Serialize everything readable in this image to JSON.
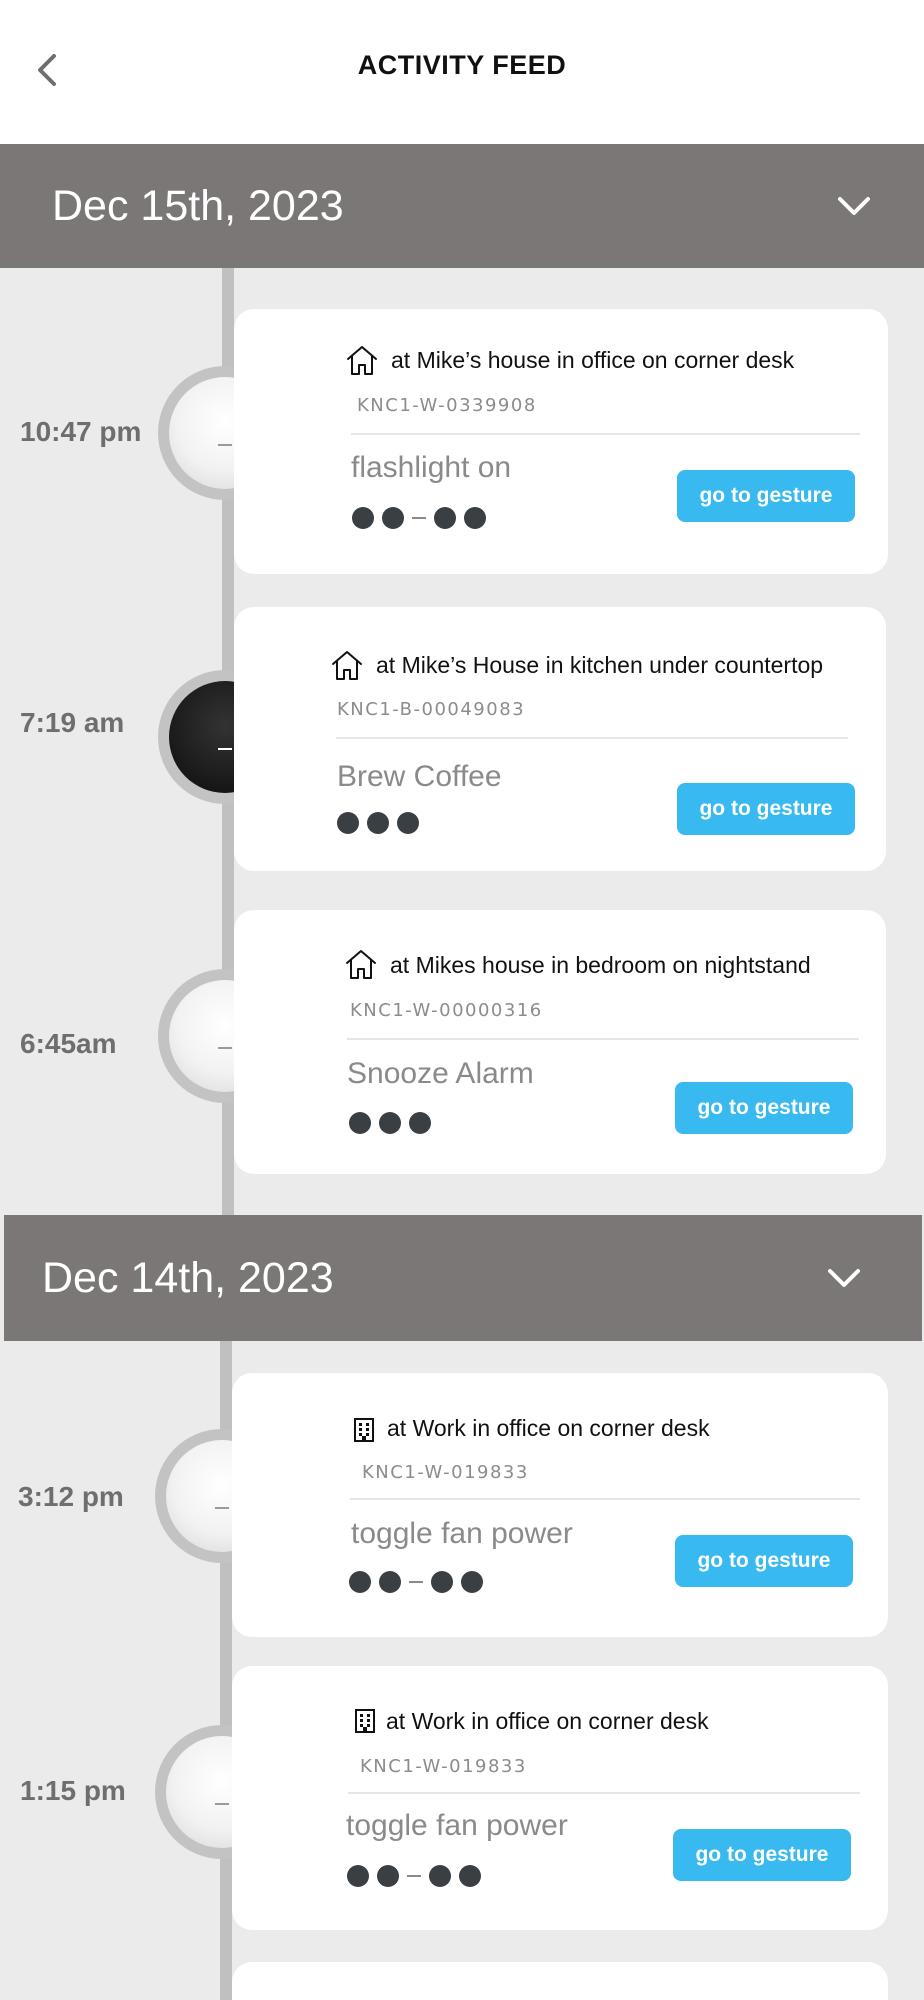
{
  "header": {
    "title": "ACTIVITY FEED"
  },
  "groups": [
    {
      "date": "Dec 15th, 2023"
    },
    {
      "date": "Dec 14th, 2023"
    }
  ],
  "entries": [
    {
      "time": "10:47 pm",
      "location": "at Mike’s house in office on corner desk",
      "location_icon": "home-icon",
      "device_id": "KNC1-W-0339908",
      "action": "flashlight on",
      "pattern": "●● – ●●",
      "device_color": "white",
      "button": "go to gesture"
    },
    {
      "time": "7:19 am",
      "location": "at Mike’s House in kitchen under countertop",
      "location_icon": "home-icon",
      "device_id": "KNC1-B-00049083",
      "action": "Brew Coffee",
      "pattern": "●●●",
      "device_color": "black",
      "button": "go to gesture"
    },
    {
      "time": "6:45am",
      "location": "at Mikes house in bedroom on nightstand",
      "location_icon": "home-icon",
      "device_id": "KNC1-W-00000316",
      "action": "Snooze Alarm",
      "pattern": "●●●",
      "device_color": "white",
      "button": "go to gesture"
    },
    {
      "time": "3:12 pm",
      "location": "at Work in office on corner desk",
      "location_icon": "building-icon",
      "device_id": "KNC1-W-019833",
      "action": "toggle fan power",
      "pattern": "●● – ●●",
      "device_color": "white",
      "button": "go to gesture"
    },
    {
      "time": "1:15 pm",
      "location": "at Work in office on corner desk",
      "location_icon": "building-icon",
      "device_id": "KNC1-W-019833",
      "action": "toggle fan power",
      "pattern": "●● – ●●",
      "device_color": "white",
      "button": "go to gesture"
    }
  ]
}
